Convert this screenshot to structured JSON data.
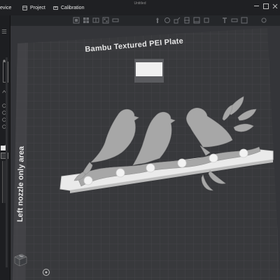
{
  "window": {
    "title": "Untitled"
  },
  "tabs": [
    {
      "label": "evice"
    },
    {
      "label": "Project"
    },
    {
      "label": "Calibration"
    }
  ],
  "plate": {
    "name": "Bambu Textured PEI Plate",
    "side_label": "Left nozzle only area"
  },
  "view_cube": {
    "label": "Top"
  },
  "colors": {
    "accent": "#00ae42",
    "plate_grid": "#46474b",
    "bed": "#3a3b3e",
    "model": "#a5a5a5"
  }
}
